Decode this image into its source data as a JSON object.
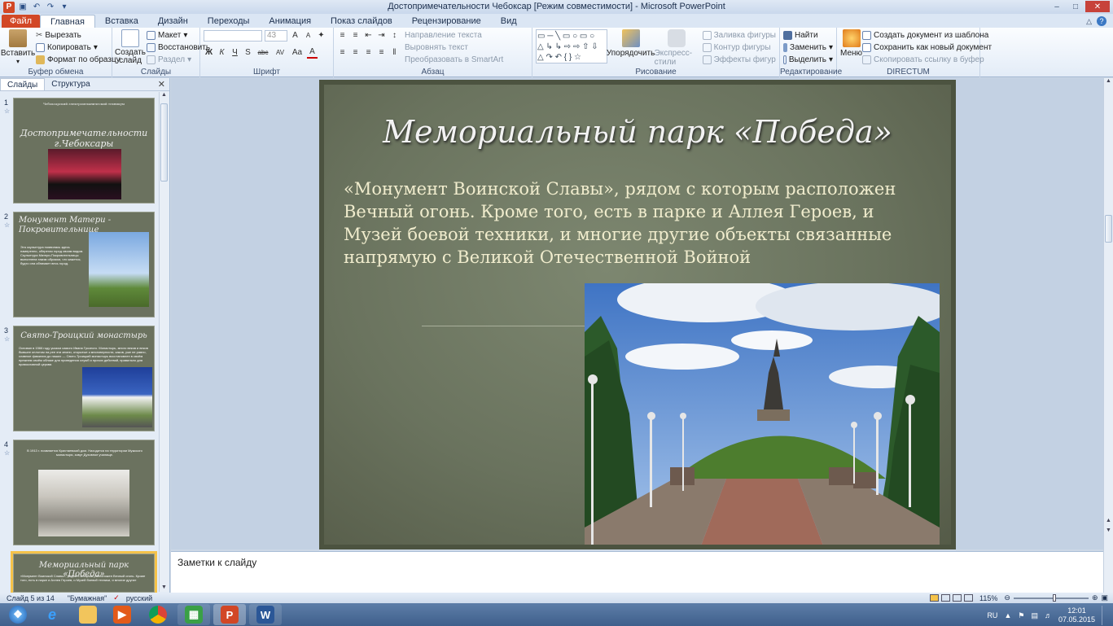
{
  "window": {
    "title": "Достопримечательности Чебоксар [Режим совместимости] - Microsoft PowerPoint"
  },
  "tabs": [
    "Файл",
    "Главная",
    "Вставка",
    "Дизайн",
    "Переходы",
    "Анимация",
    "Показ слайдов",
    "Рецензирование",
    "Вид"
  ],
  "ribbon": {
    "clipboard": {
      "paste": "Вставить",
      "cut": "Вырезать",
      "copy": "Копировать",
      "format_painter": "Формат по образцу",
      "label": "Буфер обмена"
    },
    "slides": {
      "new_slide": "Создать слайд",
      "layout": "Макет",
      "reset": "Восстановить",
      "section": "Раздел",
      "label": "Слайды"
    },
    "font": {
      "size": "43",
      "label": "Шрифт",
      "bold": "Ж",
      "italic": "К",
      "underline": "Ч",
      "strike": "S",
      "shadow": "abc",
      "spacing": "AV",
      "case": "Aa",
      "color": "A",
      "grow": "A",
      "shrink": "A"
    },
    "paragraph": {
      "text_direction": "Направление текста",
      "align_text": "Выровнять текст",
      "smartart": "Преобразовать в SmartArt",
      "label": "Абзац"
    },
    "drawing": {
      "arrange": "Упорядочить",
      "quick_styles": "Экспресс-стили",
      "fill": "Заливка фигуры",
      "outline": "Контур фигуры",
      "effects": "Эффекты фигур",
      "label": "Рисование"
    },
    "editing": {
      "find": "Найти",
      "replace": "Заменить",
      "select": "Выделить",
      "label": "Редактирование"
    },
    "directum": {
      "menu": "Меню",
      "create_from_template": "Создать документ из шаблона",
      "save_as_new": "Сохранить как новый документ",
      "copy_link": "Скопировать ссылку в буфер",
      "label": "DIRECTUM"
    }
  },
  "pane": {
    "tab_slides": "Слайды",
    "tab_outline": "Структура"
  },
  "thumbnails": [
    {
      "num": "1",
      "header": "Чебоксарский электромеханический техникум",
      "title": "Достопримечательности г.Чебоксары"
    },
    {
      "num": "2",
      "title": "Монумент Матери - Покровительнице",
      "body": "Эта скульптура появилась здесь намеренно, оберегая город своим видом. Скульптура Матери-Покровительницы выполнена таким образом, что кажется, будто она обнимает весь город."
    },
    {
      "num": "3",
      "title": "Свято-Троицкий монастырь",
      "body": "Основан в 1566 году указом самого Ивана Грозного. Монастырь, много веков и веков бывшее оплотом на рее эти земли, открытые к многоверности, каков, уже не равно, славное фамилия до наших — Свято-Троицкий монастырь восстановлен в своём прежнем своём облике для проведения служб и прочих действий, правильно для православной церкви."
    },
    {
      "num": "4",
      "body": "В 1913 г. появляется Кристаевский дом. Находится на территории Мужского монастыря, зовут Духовное училище."
    },
    {
      "num": "5",
      "title": "Мемориальный парк «Победа»",
      "body": "«Монумент Воинской Славы», рядом с которым расположен Вечный огонь. Кроме того, есть в парке и Аллея Героев, и Музей боевой техники, и многие другие"
    }
  ],
  "slide": {
    "title": "Мемориальный парк «Победа»",
    "body": "«Монумент Воинской Славы», рядом с которым расположен Вечный огонь. Кроме того, есть в парке и Аллея Героев, и Музей боевой техники, и многие другие объекты связанные напрямую с Великой Отечественной Войной"
  },
  "notes": {
    "placeholder": "Заметки к слайду"
  },
  "status": {
    "slide_of": "Слайд 5 из 14",
    "theme": "\"Бумажная\"",
    "language": "русский",
    "zoom": "115%",
    "zoom_fraction": 0.55
  },
  "tray": {
    "lang": "RU",
    "time": "12:01",
    "date": "07.05.2015"
  },
  "colors": {
    "file_tab": "#d24726",
    "selection": "#f5c34a",
    "slide_bg": "#6a735e",
    "body_text": "#f0eccd"
  }
}
